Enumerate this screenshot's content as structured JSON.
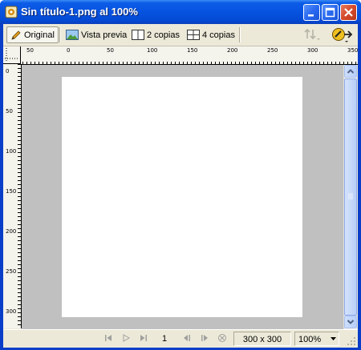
{
  "window": {
    "title": "Sin título-1.png al 100%"
  },
  "toolbar": {
    "tabs": [
      {
        "label": "Original",
        "icon": "pencil-icon"
      },
      {
        "label": "Vista previa",
        "icon": "landscape-image-icon"
      },
      {
        "label": "2 copias",
        "icon": "two-panes-icon"
      },
      {
        "label": "4 copias",
        "icon": "four-panes-icon"
      }
    ]
  },
  "rulers": {
    "horizontal_labels": [
      "50",
      "0",
      "50",
      "100",
      "150",
      "200",
      "250",
      "300",
      "350"
    ],
    "vertical_labels": [
      "0",
      "50",
      "100",
      "150",
      "200",
      "250",
      "300"
    ]
  },
  "status": {
    "frame": "1",
    "dimensions": "300 x 300",
    "zoom": "100%"
  },
  "colors": {
    "titlebar": "#0653e0",
    "canvas_bg": "#c0c0c0",
    "document": "#ffffff"
  }
}
